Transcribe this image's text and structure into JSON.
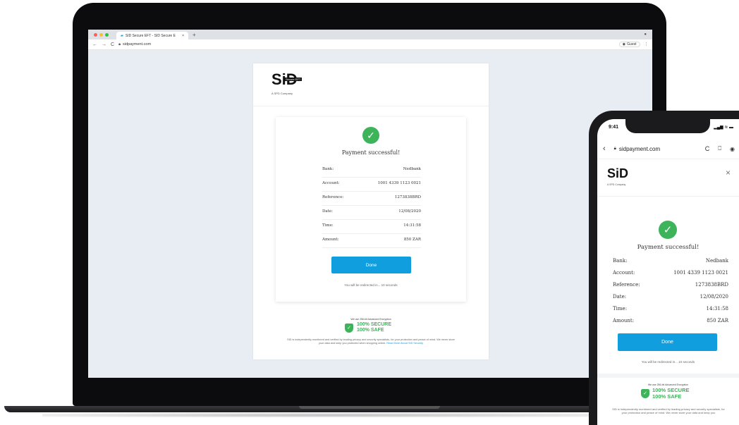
{
  "browser": {
    "tab_title": "SID Secure EFT - SID Secure E",
    "tab_close": "×",
    "new_tab": "+",
    "url": "sidpayment.com",
    "guest_label": "Guest",
    "menu": "⋮"
  },
  "brand": {
    "logo_text": "SiD",
    "logo_badge": "Secure EFT",
    "logo_sub": "A SPD Company"
  },
  "payment": {
    "title": "Payment successful!",
    "rows": [
      {
        "label": "Bank:",
        "value": "Nedbank"
      },
      {
        "label": "Account:",
        "value": "1001 4339 1123 0021"
      },
      {
        "label": "Reference:",
        "value": "1273838BRD"
      },
      {
        "label": "Date:",
        "value": "12/08/2020"
      },
      {
        "label": "Time:",
        "value": "14:31:58"
      },
      {
        "label": "Amount:",
        "value": "850 ZAR"
      }
    ],
    "done_label": "Done",
    "redirect_text": "You will be redirected in... 10 seconds"
  },
  "security": {
    "encryption_note": "We use 256-bit Advanced Encryption",
    "secure_line": "100% SECURE",
    "safe_line": "100% SAFE",
    "fine_print": "SID is independently monitored and verified by leading privacy and security specialists, for your protection and peace of mind. We never store your data and keep you protected when shopping online.",
    "read_more": "Read More About SID Security"
  },
  "phone": {
    "time": "9:41",
    "status_icons": "▂▄▆ ≋ ▬",
    "url": "sidpayment.com",
    "close": "×",
    "fine_print": "SID is independently monitored and verified by leading privacy and security specialists, for your protection and peace of mind. We never store your data and keep you"
  },
  "colors": {
    "accent_blue": "#119ede",
    "success_green": "#3db35a"
  }
}
